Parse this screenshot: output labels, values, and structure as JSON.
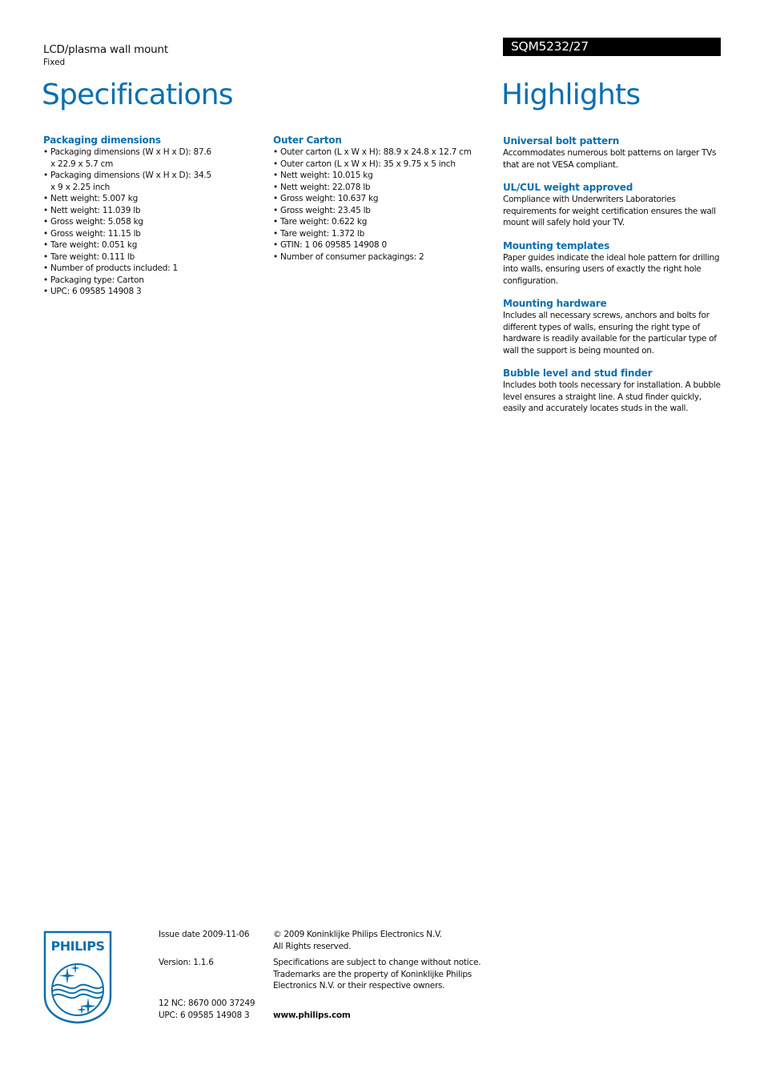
{
  "header": {
    "product_type": "LCD/plasma wall mount",
    "product_variant": "Fixed",
    "model": "SQM5232/27",
    "specs_title": "Specifications",
    "highlights_title": "Highlights"
  },
  "colors": {
    "accent": "#0b6fae",
    "model_bar_bg": "#000000",
    "model_bar_text": "#ffffff"
  },
  "specifications": [
    {
      "title": "Packaging dimensions",
      "items": [
        "Packaging dimensions (W x H x D): 87.6 x 22.9 x 5.7 cm",
        "Packaging dimensions (W x H x D): 34.5 x 9 x 2.25 inch",
        "Nett weight: 5.007 kg",
        "Nett weight: 11.039 lb",
        "Gross weight: 5.058 kg",
        "Gross weight: 11.15 lb",
        "Tare weight: 0.051 kg",
        "Tare weight: 0.111 lb",
        "Number of products included: 1",
        "Packaging type: Carton",
        "UPC: 6 09585 14908 3"
      ]
    },
    {
      "title": "Outer Carton",
      "items": [
        "Outer carton (L x W x H): 88.9 x 24.8 x 12.7 cm",
        "Outer carton (L x W x H): 35 x 9.75 x 5 inch",
        "Nett weight: 10.015 kg",
        "Nett weight: 22.078 lb",
        "Gross weight: 10.637 kg",
        "Gross weight: 23.45 lb",
        "Tare weight: 0.622 kg",
        "Tare weight: 1.372 lb",
        "GTIN: 1 06 09585 14908 0",
        "Number of consumer packagings: 2"
      ]
    }
  ],
  "highlights": [
    {
      "title": "Universal bolt pattern",
      "body": "Accommodates numerous bolt patterns on larger TVs that are not VESA compliant."
    },
    {
      "title": "UL/CUL weight approved",
      "body": "Compliance with Underwriters Laboratories requirements for weight certification ensures the wall mount will safely hold your TV."
    },
    {
      "title": "Mounting templates",
      "body": "Paper guides indicate the ideal hole pattern for drilling into walls, ensuring users of exactly the right hole configuration."
    },
    {
      "title": "Mounting hardware",
      "body": "Includes all necessary screws, anchors and bolts for different types of walls, ensuring the right type of hardware is readily available for the particular type of wall the support is being mounted on."
    },
    {
      "title": "Bubble level and stud finder",
      "body": "Includes both tools necessary for installation. A bubble level ensures a straight line. A stud finder quickly, easily and accurately locates studs in the wall."
    }
  ],
  "footer": {
    "logo_text": "PHILIPS",
    "logo_icon": "philips-shield-icon",
    "issue_date": "Issue date 2009-11-06",
    "version": "Version: 1.1.6",
    "nc12": "12 NC: 8670 000 37249",
    "upc": "UPC: 6 09585 14908 3",
    "copyright_line1": "© 2009 Koninklijke Philips Electronics N.V.",
    "copyright_line2": "All Rights reserved.",
    "disclaimer": "Specifications are subject to change without notice. Trademarks are the property of Koninklijke Philips Electronics N.V. or their respective owners.",
    "website": "www.philips.com"
  }
}
